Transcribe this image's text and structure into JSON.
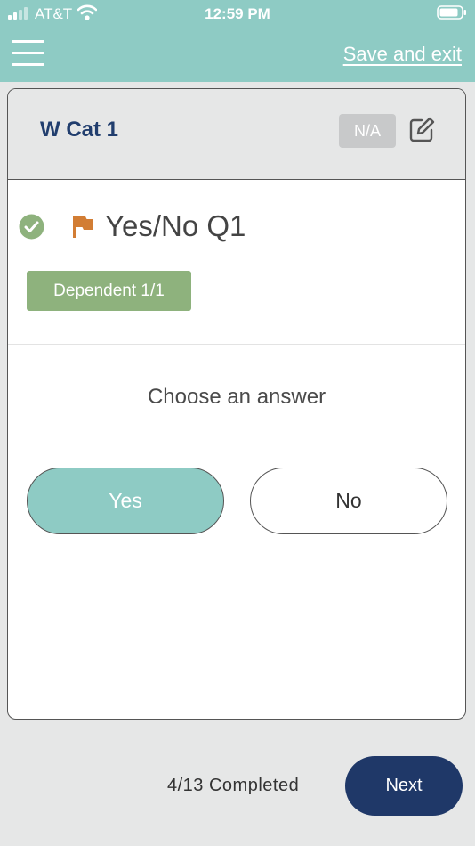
{
  "status_bar": {
    "carrier": "AT&T",
    "time": "12:59 PM"
  },
  "header": {
    "save_exit_label": "Save and exit",
    "accent_color": "#8ecbc4"
  },
  "card": {
    "category_title": "W Cat 1",
    "na_label": "N/A",
    "question_title": "Yes/No Q1",
    "dependent_badge": "Dependent 1/1",
    "prompt": "Choose an answer",
    "answers": [
      {
        "label": "Yes",
        "selected": true
      },
      {
        "label": "No",
        "selected": false
      }
    ],
    "icons": [
      "check-circle-icon",
      "flag-icon",
      "edit-icon"
    ]
  },
  "footer": {
    "progress_text": "4/13 Completed",
    "next_label": "Next",
    "completed": 4,
    "total": 13
  }
}
